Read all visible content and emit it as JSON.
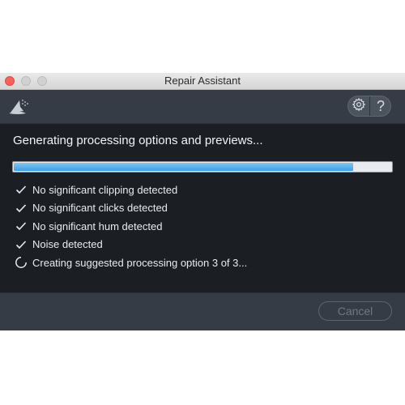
{
  "window": {
    "title": "Repair Assistant"
  },
  "toolbar": {
    "settings_icon": "gear-icon",
    "help_label": "?"
  },
  "main": {
    "heading": "Generating processing options and previews...",
    "progress": 0.9,
    "steps": [
      {
        "label": "No significant clipping detected",
        "status": "done"
      },
      {
        "label": "No significant clicks detected",
        "status": "done"
      },
      {
        "label": "No significant hum detected",
        "status": "done"
      },
      {
        "label": "Noise detected",
        "status": "done"
      },
      {
        "label": "Creating suggested processing option 3 of 3...",
        "status": "in-progress"
      }
    ]
  },
  "footer": {
    "cancel_label": "Cancel"
  },
  "colors": {
    "progress_fill": "#3d9fe4",
    "background": "#1b1f24",
    "toolbar": "#353c45"
  }
}
